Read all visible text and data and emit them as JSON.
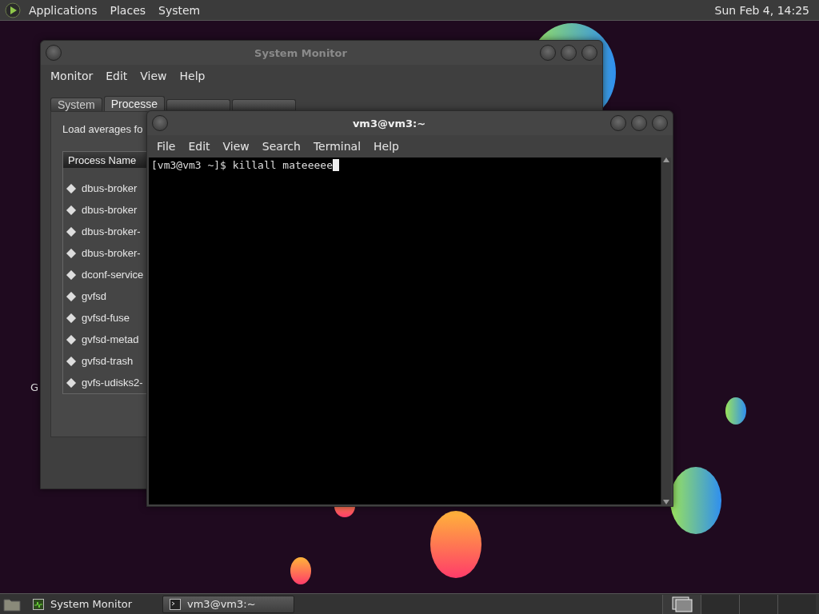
{
  "top_panel": {
    "menus": [
      "Applications",
      "Places",
      "System"
    ],
    "clock": "Sun Feb  4, 14:25"
  },
  "desktop": {
    "icon_label": "G"
  },
  "system_monitor": {
    "title": "System Monitor",
    "menus": [
      "Monitor",
      "Edit",
      "View",
      "Help"
    ],
    "tabs": [
      {
        "label": "System",
        "selected": false
      },
      {
        "label": "Processe",
        "selected": true
      },
      {
        "selected": false
      },
      {
        "selected": false
      }
    ],
    "load_averages": "Load averages fo",
    "table": {
      "columns": [
        "Process Name"
      ],
      "rows": [
        "dbus-broker",
        "dbus-broker",
        "dbus-broker-",
        "dbus-broker-",
        "dconf-service",
        "gvfsd",
        "gvfsd-fuse",
        "gvfsd-metad",
        "gvfsd-trash",
        "gvfs-udisks2-"
      ]
    }
  },
  "terminal": {
    "title": "vm3@vm3:~",
    "menus": [
      "File",
      "Edit",
      "View",
      "Search",
      "Terminal",
      "Help"
    ],
    "lines": [
      "[vm3@vm3 ~]$ killall mateeeee"
    ]
  },
  "taskbar": {
    "tasks": [
      {
        "label": "System Monitor",
        "kind": "monitor",
        "selected": false
      },
      {
        "label": "vm3@vm3:~",
        "kind": "terminal",
        "selected": true
      }
    ],
    "workspaces": [
      {
        "selected": true
      },
      {
        "selected": false
      },
      {
        "selected": false
      },
      {
        "selected": false
      }
    ]
  }
}
